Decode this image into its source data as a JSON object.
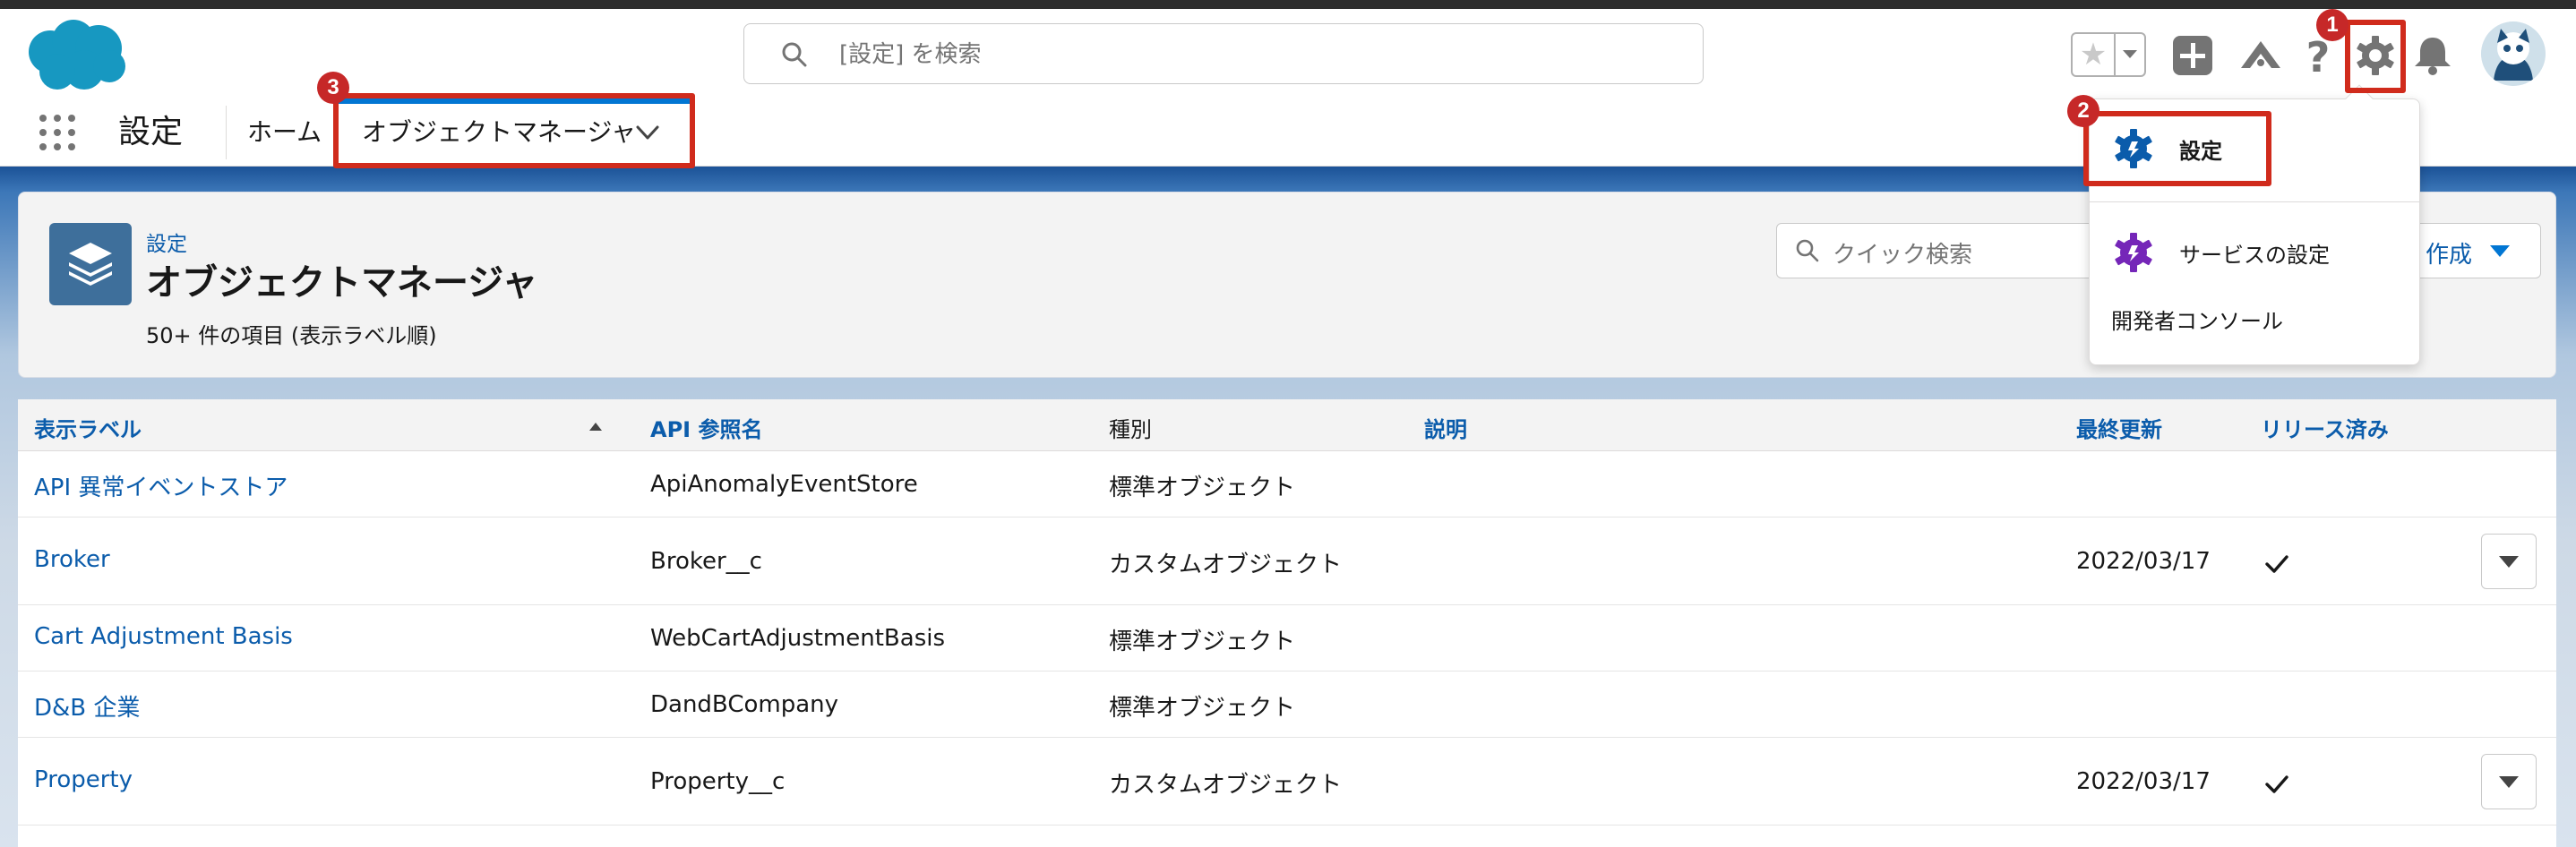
{
  "header": {
    "search_placeholder": "[設定] を検索",
    "icons": [
      "salesforce-logo",
      "star-icon",
      "chevron-down-icon",
      "plus-icon",
      "trailhead-icon",
      "help-icon",
      "gear-icon",
      "bell-icon",
      "avatar"
    ]
  },
  "nav": {
    "app_name": "設定",
    "home": "ホーム",
    "active_tab": "オブジェクトマネージャ"
  },
  "page": {
    "breadcrumb": "設定",
    "title": "オブジェクトマネージャ",
    "subtitle": "50+ 件の項目 (表示ラベル順)",
    "quick_search_placeholder": "クイック検索",
    "create_button_label": "作成"
  },
  "setup_menu": {
    "items": [
      {
        "label": "設定",
        "icon": "setup-gear-icon",
        "icon_color": "#0b5cab"
      },
      {
        "label": "サービスの設定",
        "icon": "service-setup-gear-icon",
        "icon_color": "#7526b8"
      },
      {
        "label": "開発者コンソール"
      }
    ]
  },
  "table": {
    "columns": [
      "表示ラベル",
      "API 参照名",
      "種別",
      "説明",
      "最終更新",
      "リリース済み"
    ],
    "sort_column": "表示ラベル",
    "sort_direction": "ascending",
    "rows": [
      {
        "label": "API 異常イベントストア",
        "api_name": "ApiAnomalyEventStore",
        "type": "標準オブジェクト",
        "description": "",
        "last_modified": "",
        "deployed": false,
        "menu": false
      },
      {
        "label": "Broker",
        "api_name": "Broker__c",
        "type": "カスタムオブジェクト",
        "description": "",
        "last_modified": "2022/03/17",
        "deployed": true,
        "menu": true
      },
      {
        "label": "Cart Adjustment Basis",
        "api_name": "WebCartAdjustmentBasis",
        "type": "標準オブジェクト",
        "description": "",
        "last_modified": "",
        "deployed": false,
        "menu": false
      },
      {
        "label": "D&B 企業",
        "api_name": "DandBCompany",
        "type": "標準オブジェクト",
        "description": "",
        "last_modified": "",
        "deployed": false,
        "menu": false
      },
      {
        "label": "Property",
        "api_name": "Property__c",
        "type": "カスタムオブジェクト",
        "description": "",
        "last_modified": "2022/03/17",
        "deployed": true,
        "menu": true
      }
    ]
  },
  "annotations": {
    "badges": [
      "1",
      "2",
      "3"
    ],
    "highlight_color": "#d02b1c",
    "badge_color": "#c62828"
  },
  "colors": {
    "link": "#0b5cab",
    "brand": "#0176d3",
    "header_band": "#1b5297"
  }
}
